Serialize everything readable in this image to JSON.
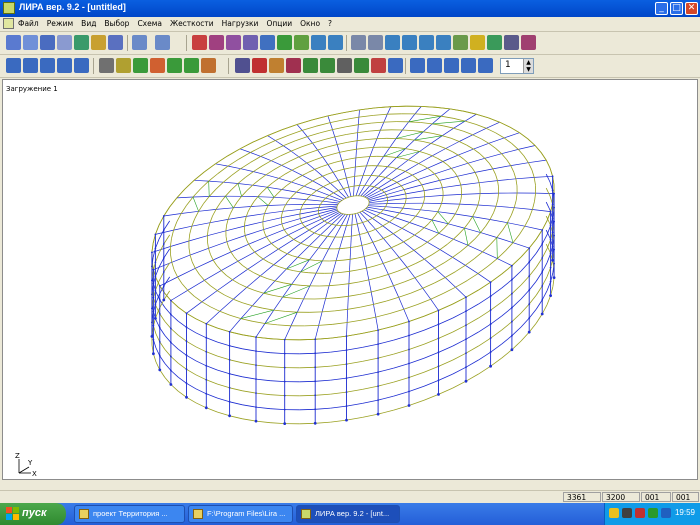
{
  "window": {
    "title": "ЛИРА  вер. 9.2 - [untitled]",
    "min_label": "_",
    "max_label": "□",
    "close_label": "✕"
  },
  "menu": {
    "items": [
      "Файл",
      "Режим",
      "Вид",
      "Выбор",
      "Схема",
      "Жесткости",
      "Нагрузки",
      "Опции",
      "Окно",
      "?"
    ]
  },
  "toolbar2": {
    "spin_value": "1"
  },
  "canvas": {
    "load_label": "Загружение 1",
    "axis_z": "Z",
    "axis_y": "Y",
    "axis_x": "X",
    "model_colors": {
      "rings": "#9aa020",
      "frames": "#1a2ad0",
      "nodes": "#2030d0",
      "braces": "#22a020"
    }
  },
  "status": {
    "fields": [
      "3361",
      "3200",
      "001",
      "001"
    ]
  },
  "taskbar": {
    "start_label": "пуск",
    "tasks": [
      {
        "label": "проект Территория ...",
        "icon": "folder-icon",
        "active": false
      },
      {
        "label": "F:\\Program Files\\Lira ...",
        "icon": "folder-icon",
        "active": false
      },
      {
        "label": "ЛИРА  вер. 9.2 - [unt...",
        "icon": "app-icon",
        "active": true
      }
    ],
    "clock": "19:59"
  }
}
